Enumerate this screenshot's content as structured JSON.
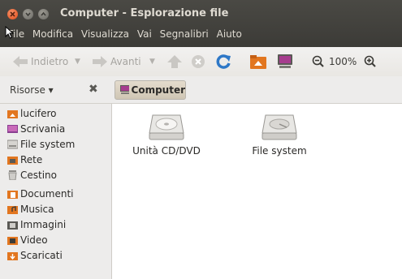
{
  "window": {
    "title": "Computer - Esplorazione file"
  },
  "menubar": {
    "items": [
      "File",
      "Modifica",
      "Visualizza",
      "Vai",
      "Segnalibri",
      "Aiuto"
    ]
  },
  "toolbar": {
    "back_label": "Indietro",
    "forward_label": "Avanti",
    "zoom_level": "100%"
  },
  "places": {
    "label": "Risorse ▾"
  },
  "pathbar": {
    "current": "Computer"
  },
  "sidebar": {
    "items": [
      {
        "label": "lucifero",
        "icon": "home-folder-icon"
      },
      {
        "label": "Scrivania",
        "icon": "desktop-icon"
      },
      {
        "label": "File system",
        "icon": "drive-icon"
      },
      {
        "label": "Rete",
        "icon": "network-icon"
      },
      {
        "label": "Cestino",
        "icon": "trash-icon"
      },
      {
        "label": "Documenti",
        "icon": "documents-folder-icon"
      },
      {
        "label": "Musica",
        "icon": "music-folder-icon"
      },
      {
        "label": "Immagini",
        "icon": "pictures-folder-icon"
      },
      {
        "label": "Video",
        "icon": "video-folder-icon"
      },
      {
        "label": "Scaricati",
        "icon": "downloads-folder-icon"
      }
    ]
  },
  "main": {
    "items": [
      {
        "label": "Unità CD/DVD",
        "icon": "optical-drive-icon"
      },
      {
        "label": "File system",
        "icon": "harddisk-icon"
      }
    ]
  },
  "colors": {
    "title_bar": "#3c3b37",
    "close_button": "#df4a16",
    "accent": "#dd4814"
  }
}
